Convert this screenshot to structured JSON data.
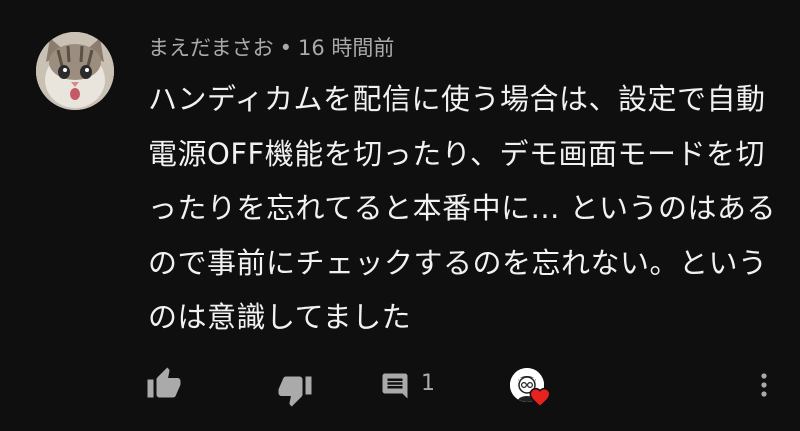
{
  "comment": {
    "author": "まえだまさお",
    "separator": "•",
    "time": "16 時間前",
    "lines": [
      "ハンディカムを配信に使う場合は、設定で自動",
      "電源OFF機能を切ったり、デモ画面モードを切",
      "ったりを忘れてると本番中に... というのはある",
      "ので事前にチェックするのを忘れない。という",
      "のは意識してました"
    ]
  },
  "actions": {
    "like_icon": "thumb-up-icon",
    "dislike_icon": "thumb-down-icon",
    "reply_icon": "comment-icon",
    "reply_count": "1",
    "creator_heart_icon": "heart-icon",
    "more_icon": "more-vert-icon"
  },
  "colors": {
    "background": "#0f0f0f",
    "text": "#f1f1f1",
    "secondary_text": "#aaaaaa",
    "heart": "#e8231f"
  }
}
